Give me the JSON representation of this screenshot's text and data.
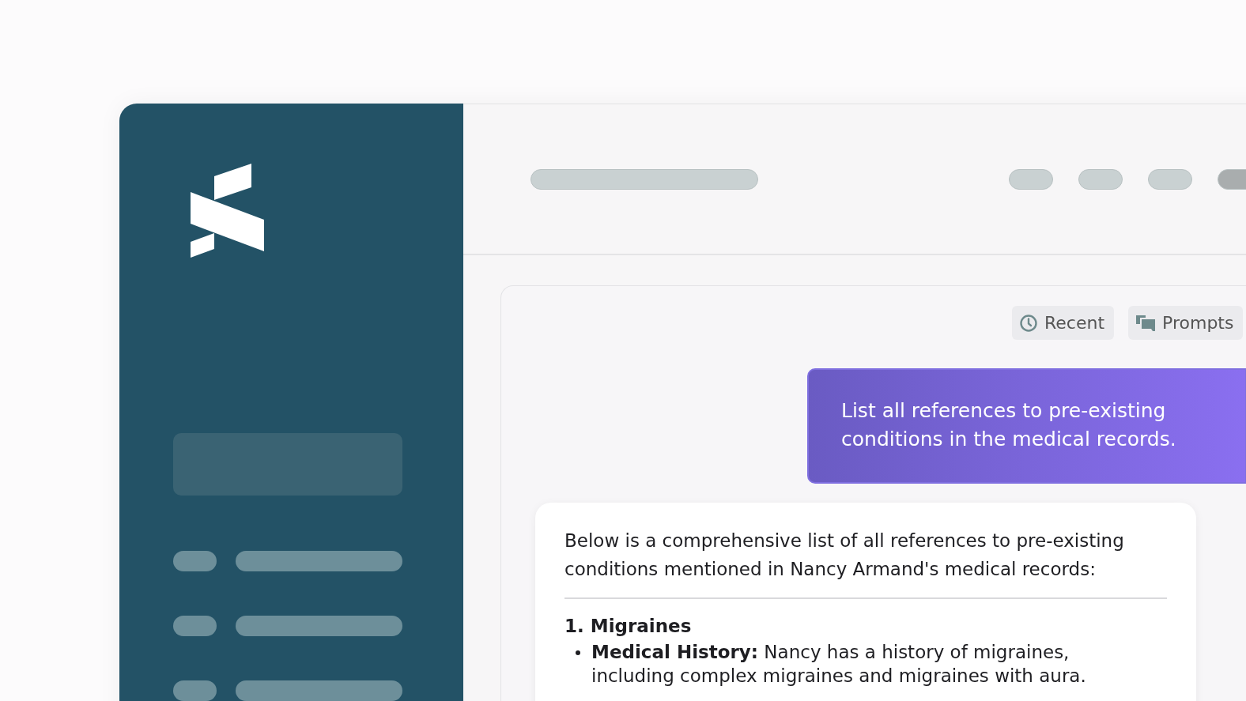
{
  "toolbar": {
    "buttons": [
      {
        "kind": "clock",
        "label": "Recent"
      },
      {
        "kind": "stack",
        "label": "Prompts"
      }
    ]
  },
  "chat": {
    "user_message": "List all references to pre-existing conditions in the medical records.",
    "response": {
      "intro": "Below is a comprehensive list of all references to pre-existing conditions mentioned in Nancy Armand's medical records:",
      "sections": [
        {
          "heading": "1. Migraines",
          "bullets": [
            {
              "text": "**Medical History:** Nancy has a history of migraines, including complex migraines and migraines with aura."
            }
          ]
        }
      ]
    }
  }
}
